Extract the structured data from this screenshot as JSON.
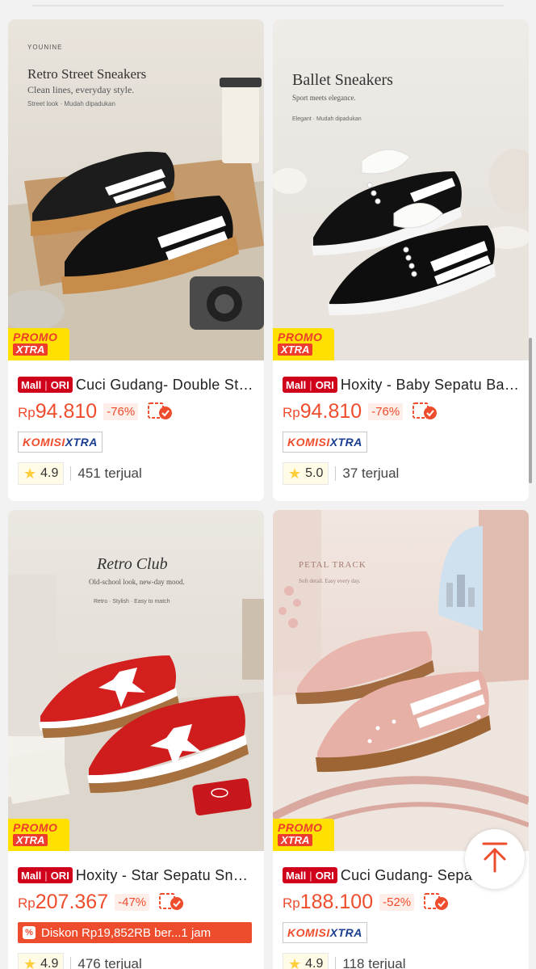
{
  "products": [
    {
      "poster": {
        "brand": "YOUNINE",
        "title": "Retro Street Sneakers",
        "subtitle": "Clean lines, everyday style.",
        "tagline": "Street look · Mudah dipadukan"
      },
      "mall_label": "Mall",
      "ori_label": "ORI",
      "name": "Cuci Gudang- Double Stripe Sneakers",
      "currency": "Rp",
      "price": "94.810",
      "discount": "-76%",
      "badge": "komisi",
      "komisi_a": "KOMISI",
      "komisi_b": "XTRA",
      "rating": "4.9",
      "sold": "451 terjual"
    },
    {
      "poster": {
        "brand": "",
        "title": "Ballet Sneakers",
        "subtitle": "Sport meets elegance.",
        "tagline": "Elegant · Mudah dipadukan"
      },
      "mall_label": "Mall",
      "ori_label": "ORI",
      "name": "Hoxity - Baby Sepatu Ballet Sneakers",
      "currency": "Rp",
      "price": "94.810",
      "discount": "-76%",
      "badge": "komisi",
      "komisi_a": "KOMISI",
      "komisi_b": "XTRA",
      "rating": "5.0",
      "sold": "37 terjual"
    },
    {
      "poster": {
        "brand": "",
        "title": "Retro Club",
        "subtitle": "Old-school look, new-day mood.",
        "tagline": "Retro · Stylish · Easy to match"
      },
      "mall_label": "Mall",
      "ori_label": "ORI",
      "name": "Hoxity - Star Sepatu Sneakers",
      "currency": "Rp",
      "price": "207.367",
      "discount": "-47%",
      "badge": "diskon",
      "diskon_text": "Diskon Rp19,852RB ber...1 jam",
      "rating": "4.9",
      "sold": "476 terjual"
    },
    {
      "poster": {
        "brand": "",
        "title": "PETAL TRACK",
        "subtitle": "Soft detail. Easy every day.",
        "tagline": ""
      },
      "mall_label": "Mall",
      "ori_label": "ORI",
      "name": "Cuci Gudang- Sepatu",
      "currency": "Rp",
      "price": "188.100",
      "discount": "-52%",
      "badge": "komisi",
      "komisi_a": "KOMISI",
      "komisi_b": "XTRA",
      "rating": "4.9",
      "sold": "118 terjual"
    }
  ],
  "promo": {
    "line1": "PROMO",
    "line2": "XTRA"
  },
  "icons": {
    "cod": "cod-check-icon",
    "star": "star-icon",
    "back_to_top": "arrow-up-icon"
  },
  "colors": {
    "accent": "#ee4d2d",
    "mall": "#d0011b",
    "promo_bg": "#ffe000",
    "komisi_blue": "#1a3d8f"
  }
}
